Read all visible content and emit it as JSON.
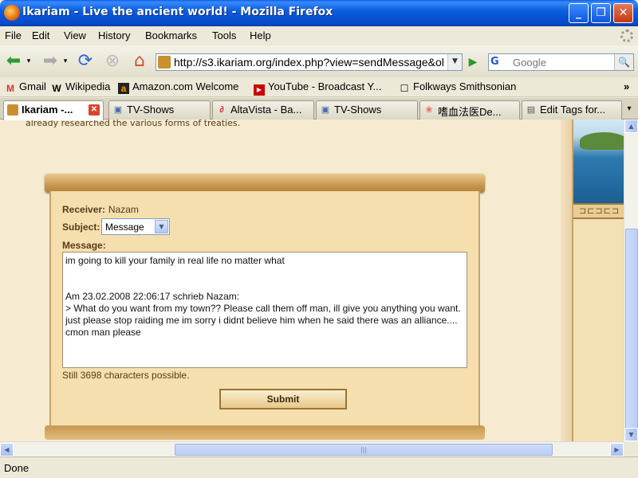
{
  "window": {
    "title": "Ikariam - Live the ancient world! - Mozilla Firefox",
    "minimize": "_",
    "maximize": "❐",
    "close": "✕"
  },
  "menu": [
    "File",
    "Edit",
    "View",
    "History",
    "Bookmarks",
    "Tools",
    "Help"
  ],
  "nav": {
    "url": "http://s3.ikariam.org/index.php?view=sendMessage&ol",
    "search_placeholder": "Google",
    "search_engine": "G"
  },
  "bookmarks": [
    {
      "icon": "M",
      "label": "Gmail"
    },
    {
      "icon": "W",
      "label": "Wikipedia"
    },
    {
      "icon": "a",
      "label": "Amazon.com Welcome"
    },
    {
      "icon": "▶",
      "label": "YouTube - Broadcast Y..."
    },
    {
      "icon": "☐",
      "label": "Folkways Smithsonian"
    }
  ],
  "bookmarks_more": "»",
  "tabs": [
    {
      "label": "Ikariam -...",
      "active": true
    },
    {
      "label": "TV-Shows"
    },
    {
      "label": "AltaVista - Ba..."
    },
    {
      "label": "TV-Shows"
    },
    {
      "label": "嗜血法医De..."
    },
    {
      "label": "Edit Tags for..."
    }
  ],
  "page": {
    "cut_text": "already researched the various forms of treaties.",
    "receiver_label": "Receiver:",
    "receiver_value": "Nazam",
    "subject_label": "Subject:",
    "subject_value": "Message",
    "message_label": "Message:",
    "message_line1": "im going to kill your family in real life no matter what",
    "quote_header": "Am 23.02.2008 22:06:17 schrieb Nazam:",
    "quote_body": "> What do you want from my town??  Please call them off man, ill give you anything you want.  just please stop raiding me im sorry i didnt believe him when he said there was an alliance.... cmon man please",
    "chars_left": "Still 3698 characters possible.",
    "submit_label": "Submit"
  },
  "status": "Done",
  "colors": {
    "titlebar": "#0a5ee0",
    "parchment": "#f5dfae",
    "page_bg": "#f6ebd0",
    "text_brown": "#5a3a1a"
  }
}
